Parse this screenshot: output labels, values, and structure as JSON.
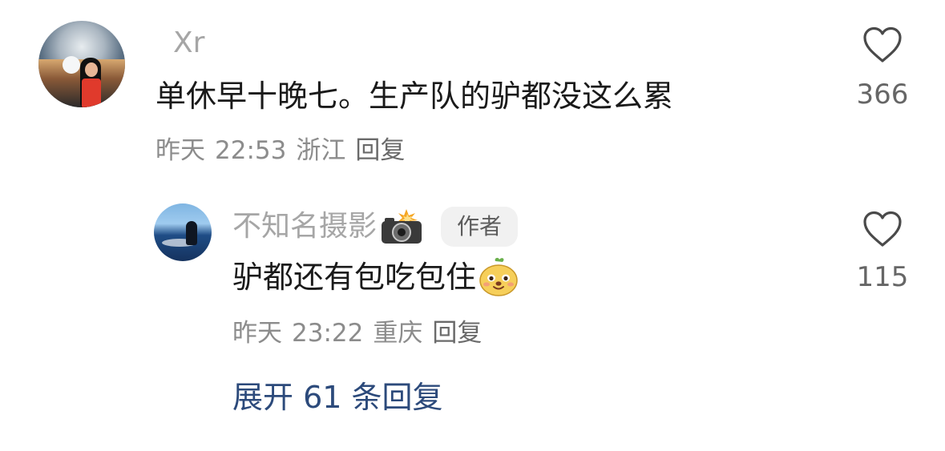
{
  "comments": [
    {
      "username": "Xr",
      "text": "单休早十晚七。生产队的驴都没这么累",
      "date": "昨天",
      "time": "22:53",
      "location": "浙江",
      "reply_label": "回复",
      "likes": "366"
    }
  ],
  "replies": [
    {
      "username": "不知名摄影",
      "badge": "作者",
      "text": "驴都还有包吃包住",
      "date": "昨天",
      "time": "23:22",
      "location": "重庆",
      "reply_label": "回复",
      "likes": "115"
    }
  ],
  "expand": {
    "label": "展开 61 条回复"
  },
  "icons": {
    "like": "heart-outline-icon",
    "camera": "camera-flash-icon",
    "emoji": "dog-face-emoji-icon"
  },
  "colors": {
    "link": "#2c4a7b",
    "username": "#a6a6a6",
    "meta": "#8c8c8c"
  }
}
